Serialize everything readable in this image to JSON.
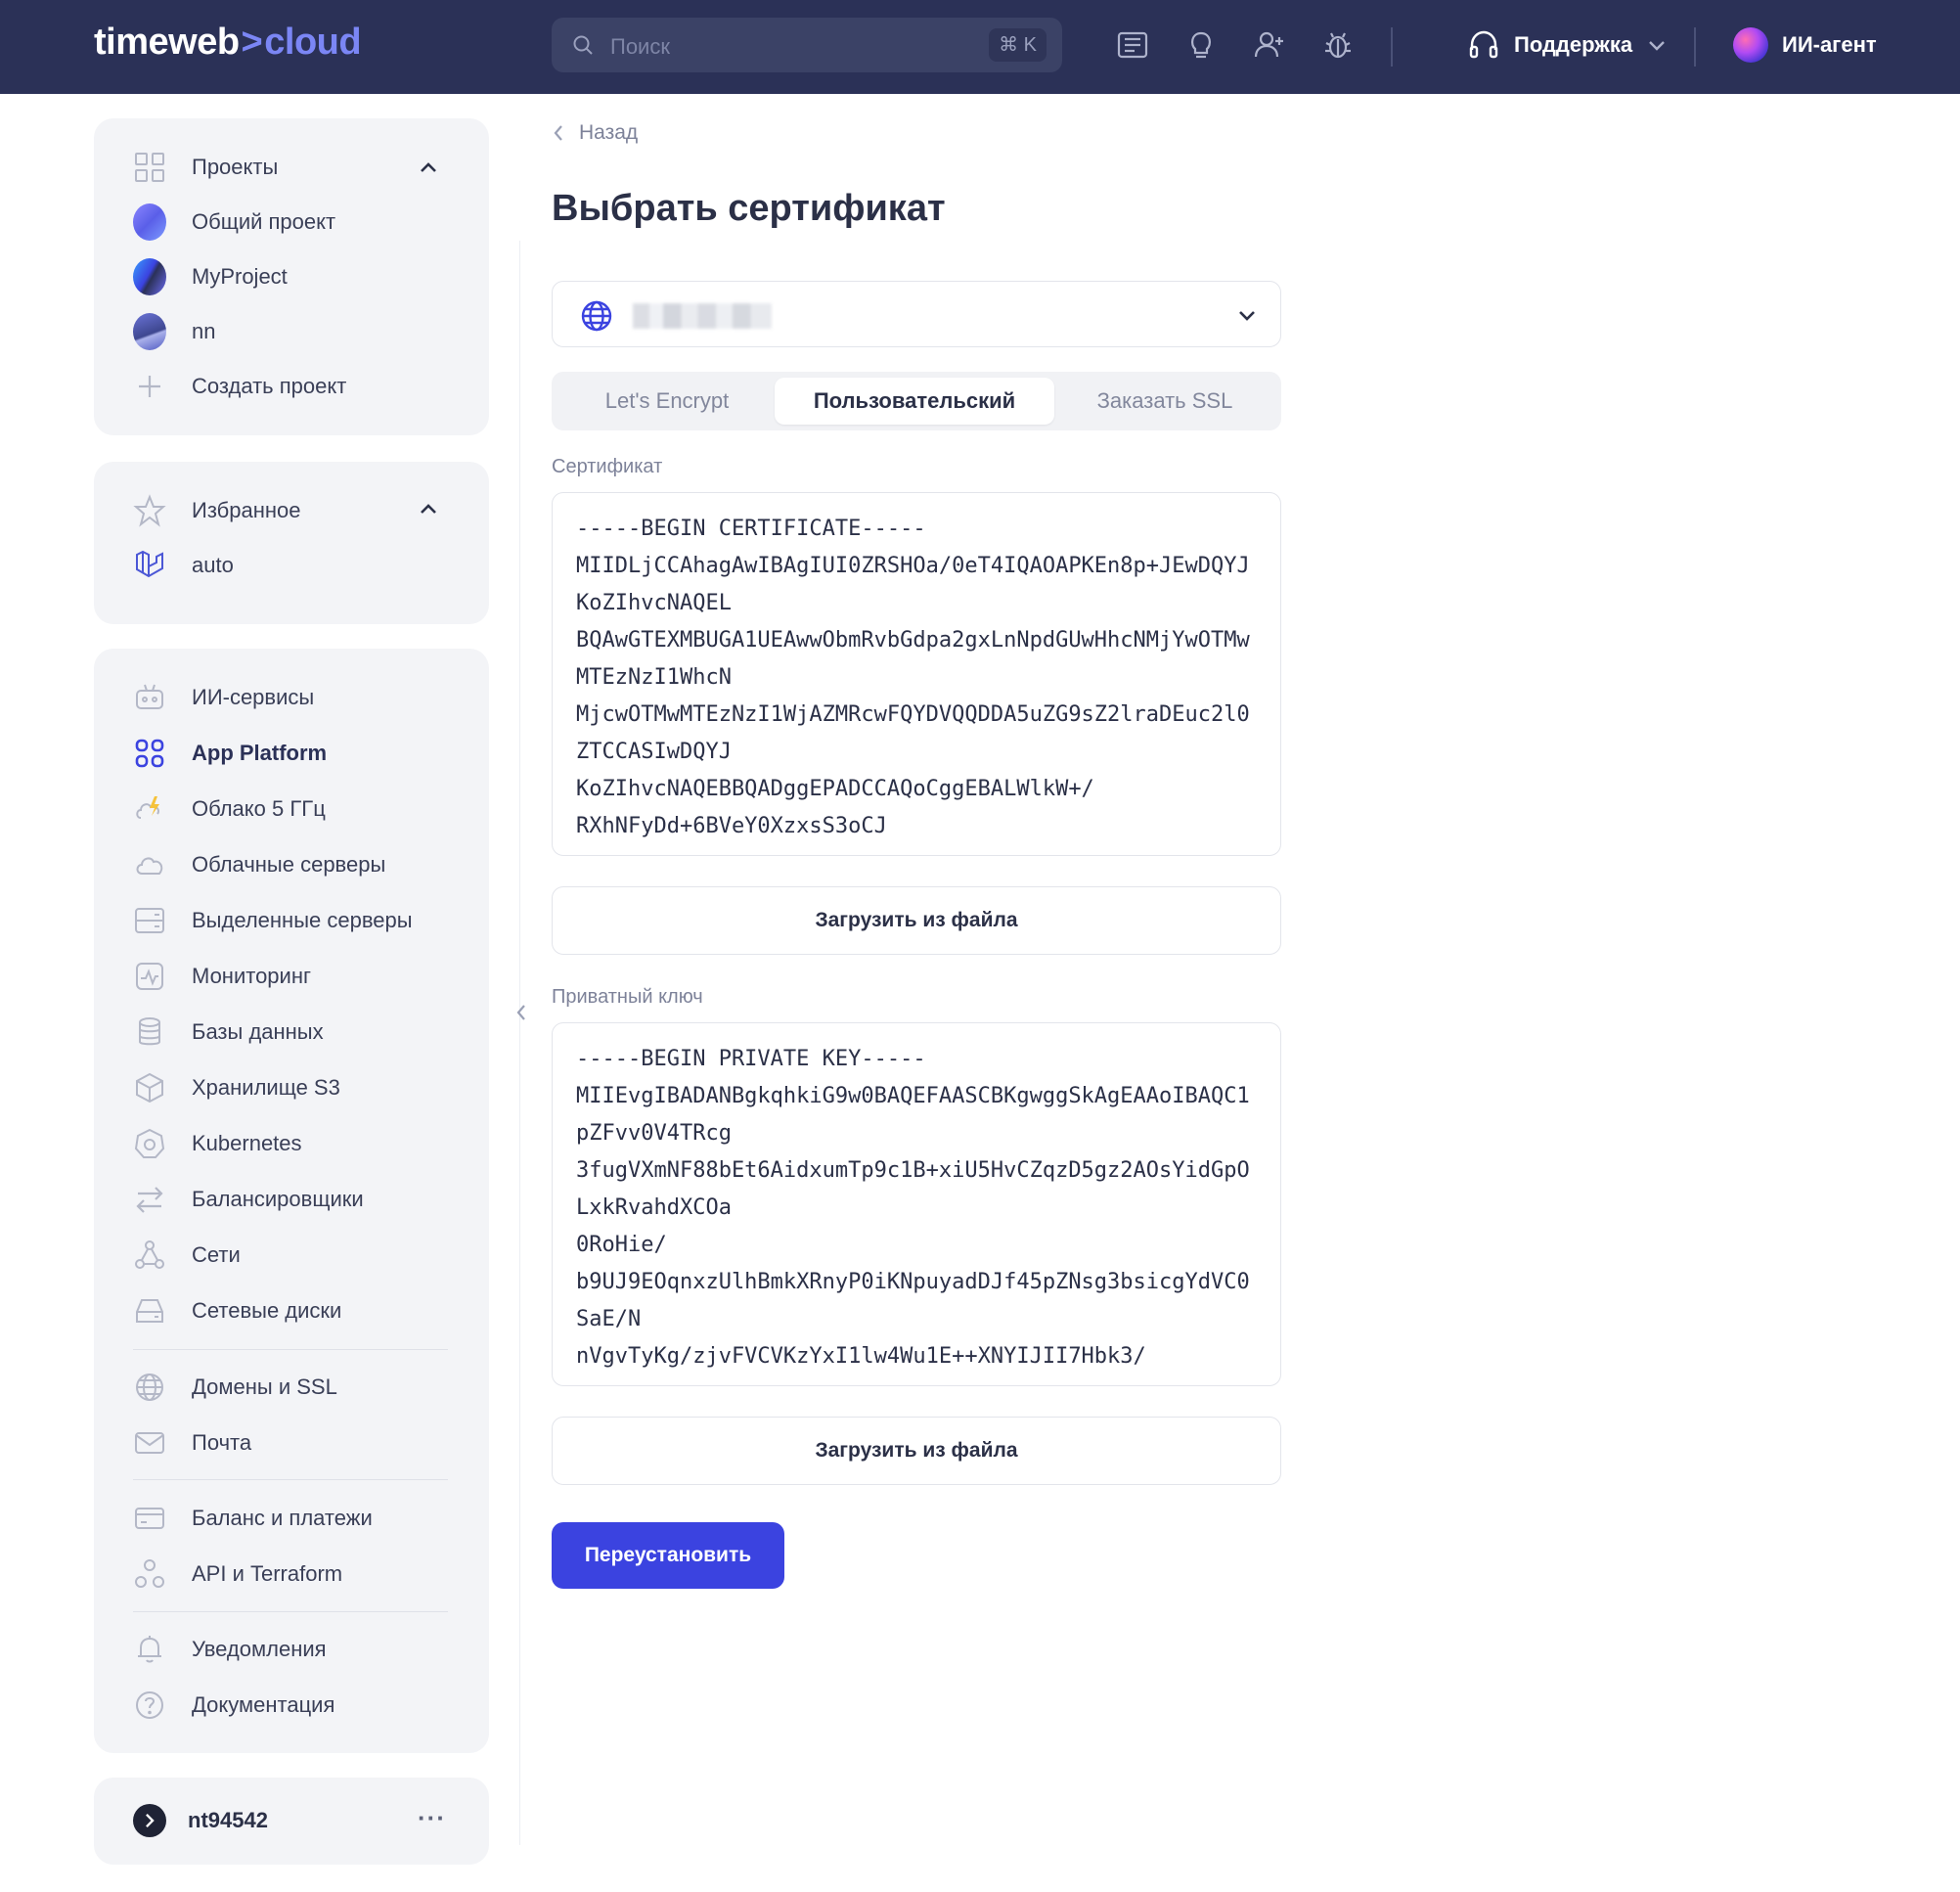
{
  "topbar": {
    "logo_left": "timeweb",
    "logo_arrow": ">",
    "logo_right": "cloud",
    "search_placeholder": "Поиск",
    "search_shortcut": "⌘ K",
    "support_label": "Поддержка",
    "agent_label": "ИИ-агент"
  },
  "sidebar": {
    "projects": {
      "title": "Проекты",
      "items": [
        "Общий проект",
        "MyProject",
        "nn"
      ],
      "create_label": "Создать проект"
    },
    "favorites": {
      "title": "Избранное",
      "items": [
        "auto"
      ]
    },
    "services": [
      "ИИ-сервисы",
      "App Platform",
      "Облако 5 ГГц",
      "Облачные серверы",
      "Выделенные серверы",
      "Мониторинг",
      "Базы данных",
      "Хранилище S3",
      "Kubernetes",
      "Балансировщики",
      "Сети",
      "Сетевые диски"
    ],
    "domains": [
      "Домены и SSL",
      "Почта"
    ],
    "billing": [
      "Баланс и платежи",
      "API и Terraform"
    ],
    "misc": [
      "Уведомления",
      "Документация"
    ],
    "account": {
      "name": "nt94542",
      "more": "···"
    },
    "active_item": "App Platform"
  },
  "main": {
    "back_label": "Назад",
    "title": "Выбрать сертификат",
    "tabs": [
      "Let's Encrypt",
      "Пользовательский",
      "Заказать SSL"
    ],
    "active_tab": "Пользовательский",
    "certificate": {
      "label": "Сертификат",
      "value": "-----BEGIN CERTIFICATE-----\nMIIDLjCCAhagAwIBAgIUI0ZRSHOa/0eT4IQAOAPKEn8p+JEwDQYJ\nKoZIhvcNAQEL\nBQAwGTEXMBUGA1UEAwwObmRvbGdpa2gxLnNpdGUwHhcNMjYwOTMw\nMTEzNzI1WhcN\nMjcwOTMwMTEzNzI1WjAZMRcwFQYDVQQDDA5uZG9sZ2lraDEuc2l0\nZTCCASIwDQYJ\nKoZIhvcNAQEBBQADggEPADCCAQoCggEBALWlkW+/\nRXhNFyDd+6BVeY0XzxsS3oCJ",
      "upload_label": "Загрузить из файла"
    },
    "private_key": {
      "label": "Приватный ключ",
      "value": "-----BEGIN PRIVATE KEY-----\nMIIEvgIBADANBgkqhkiG9w0BAQEFAASCBKgwggSkAgEAAoIBAQC1\npZFvv0V4TRcg\n3fugVXmNF88bEt6AidxumTp9c1B+xiU5HvCZqzD5gz2AOsYidGpO\nLxkRvahdXCOa\n0RoHie/\nb9UJ9EOqnxzUlhBmkXRnyP0iKNpuyadDJf45pZNsg3bsicgYdVC0\nSaE/N\nnVgvTyKg/zjvFVCVKzYxI1lw4Wu1E++XNYIJII7Hbk3/",
      "upload_label": "Загрузить из файла"
    },
    "submit_label": "Переустановить"
  },
  "colors": {
    "topbar_bg": "#2b3157",
    "accent": "#3b43e0",
    "logo_accent": "#7b86f5",
    "sidebar_bg": "#f3f4f7"
  }
}
